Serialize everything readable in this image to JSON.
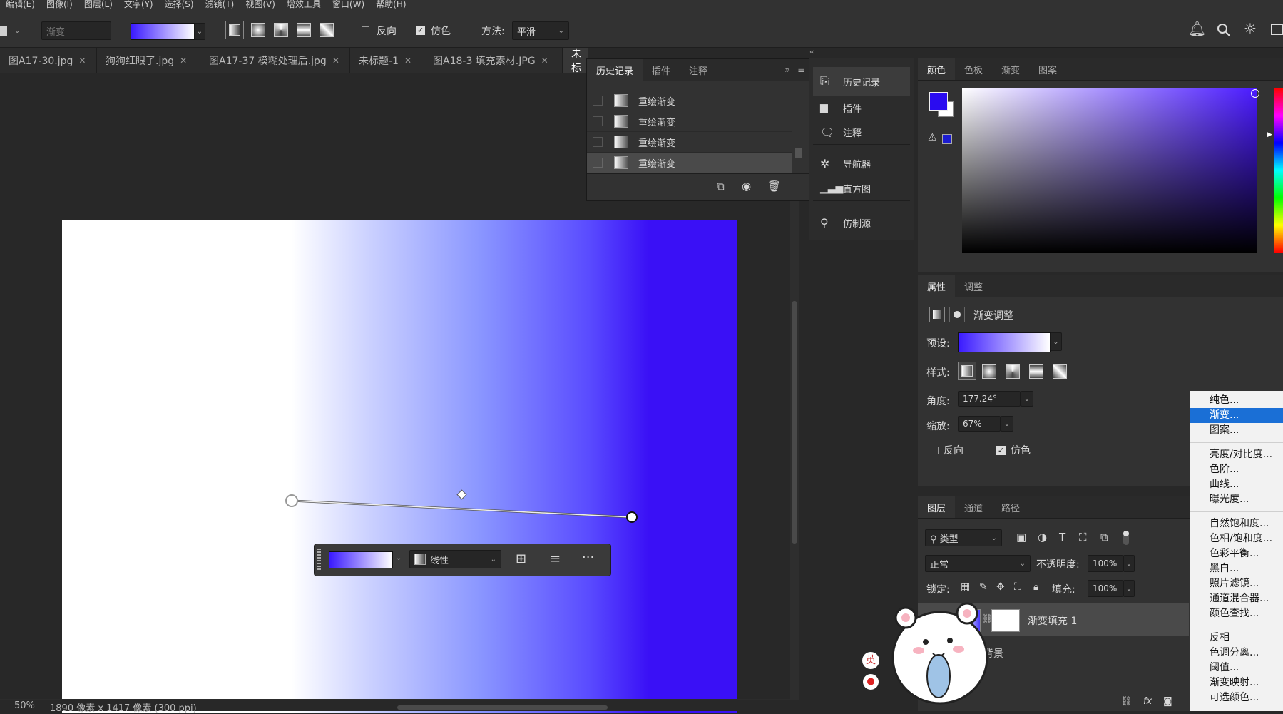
{
  "menubar": {
    "items": [
      "编辑(E)",
      "图像(I)",
      "图层(L)",
      "文字(Y)",
      "选择(S)",
      "滤镜(T)",
      "视图(V)",
      "增效工具",
      "窗口(W)",
      "帮助(H)"
    ]
  },
  "options": {
    "preset_label": "渐变",
    "reverse_label": "反向",
    "dither_label": "仿色",
    "method_label": "方法:",
    "method_value": "平滑"
  },
  "tabs": [
    {
      "label": "图A17-30.jpg"
    },
    {
      "label": "狗狗红眼了.jpg"
    },
    {
      "label": "图A17-37 模糊处理后.jpg"
    },
    {
      "label": "未标题-1"
    },
    {
      "label": "图A18-3 填充素材.JPG"
    },
    {
      "label": "未标"
    }
  ],
  "history_panel": {
    "tabs": [
      "历史记录",
      "插件",
      "注释"
    ],
    "items": [
      "重绘渐变",
      "重绘渐变",
      "重绘渐变",
      "重绘渐变"
    ]
  },
  "dock": {
    "items": [
      "历史记录",
      "插件",
      "注释",
      "导航器",
      "直方图",
      "仿制源"
    ]
  },
  "color_panel": {
    "tabs": [
      "颜色",
      "色板",
      "渐变",
      "图案"
    ],
    "fg_color": "#2a0cf0",
    "hue_color": "#4a1aff"
  },
  "gradient_toolbar": {
    "type_label": "线性"
  },
  "properties": {
    "tabs": [
      "属性",
      "调整"
    ],
    "title": "渐变调整",
    "preset_label": "预设:",
    "style_label": "样式:",
    "angle_label": "角度:",
    "angle_value": "177.24°",
    "scale_label": "缩放:",
    "scale_value": "67%",
    "reverse_label": "反向",
    "dither_label": "仿色"
  },
  "layers": {
    "tabs": [
      "图层",
      "通道",
      "路径"
    ],
    "filter_label": "类型",
    "blend_mode": "正常",
    "opacity_label": "不透明度:",
    "opacity_value": "100%",
    "lock_label": "锁定:",
    "fill_label": "填充:",
    "fill_value": "100%",
    "rows": [
      "渐变填充 1",
      "背景"
    ]
  },
  "status": {
    "zoom": "50%",
    "doc_info": "1890 像素 x 1417 像素 (300 ppi)"
  },
  "ime": {
    "label": "英"
  },
  "adjust_menu": {
    "groups": [
      [
        "纯色...",
        "渐变...",
        "图案..."
      ],
      [
        "亮度/对比度...",
        "色阶...",
        "曲线...",
        "曝光度..."
      ],
      [
        "自然饱和度...",
        "色相/饱和度...",
        "色彩平衡...",
        "黑白...",
        "照片滤镜...",
        "通道混合器...",
        "颜色查找..."
      ],
      [
        "反相",
        "色调分离...",
        "阈值...",
        "渐变映射...",
        "可选颜色..."
      ]
    ],
    "selected": "渐变..."
  }
}
